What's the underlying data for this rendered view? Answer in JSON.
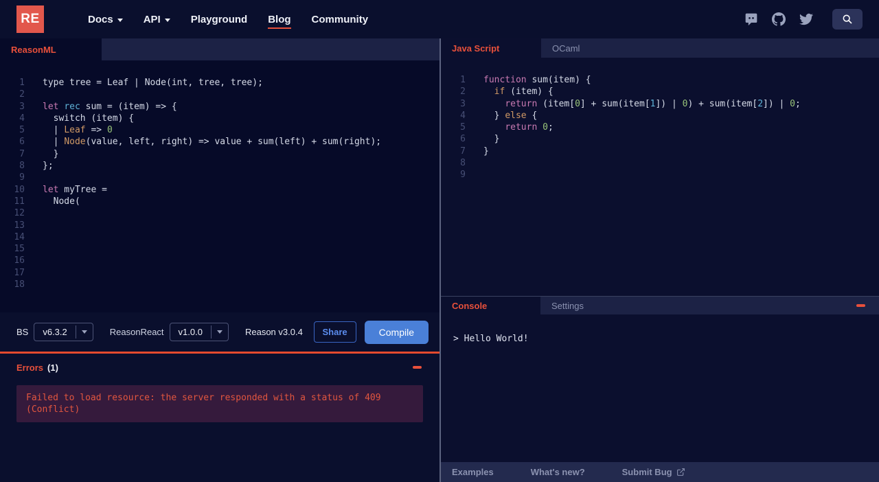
{
  "navbar": {
    "logo": "RE",
    "items": [
      {
        "label": "Docs"
      },
      {
        "label": "API"
      },
      {
        "label": "Playground"
      },
      {
        "label": "Blog"
      },
      {
        "label": "Community"
      }
    ],
    "icons": [
      "discord-icon",
      "github-icon",
      "twitter-icon",
      "search-icon"
    ]
  },
  "left": {
    "tab": "ReasonML",
    "code": [
      [
        [
          "w",
          "type tree = Leaf | Node(int, tree, tree);"
        ]
      ],
      [],
      [
        [
          "p",
          "let"
        ],
        [
          "w",
          " "
        ],
        [
          "c",
          "rec"
        ],
        [
          "w",
          " sum = (item) => {"
        ]
      ],
      [
        [
          "w",
          "  switch (item) {"
        ]
      ],
      [
        [
          "w",
          "  | "
        ],
        [
          "o",
          "Leaf"
        ],
        [
          "w",
          " => "
        ],
        [
          "g",
          "0"
        ]
      ],
      [
        [
          "w",
          "  | "
        ],
        [
          "o",
          "Node"
        ],
        [
          "w",
          "(value, left, right) => value + sum(left) + sum(right);"
        ]
      ],
      [
        [
          "w",
          "  }"
        ]
      ],
      [
        [
          "w",
          "};"
        ]
      ],
      [],
      [
        [
          "p",
          "let"
        ],
        [
          "w",
          " myTree ="
        ]
      ],
      [
        [
          "w",
          "  Node("
        ]
      ],
      [],
      [],
      [],
      [],
      [],
      [],
      []
    ],
    "toolbar": {
      "bs_label": "BS",
      "bs_version": "v6.3.2",
      "reasonreact_label": "ReasonReact",
      "reasonreact_version": "v1.0.0",
      "reason_version": "Reason v3.0.4",
      "share_label": "Share",
      "compile_label": "Compile"
    },
    "errors": {
      "title": "Errors",
      "count": "(1)",
      "message": "Failed to load resource: the server responded with a status of 409 (Conflict)"
    }
  },
  "right": {
    "tab_active": "Java Script",
    "tab_inactive": "OCaml",
    "code": [
      [
        [
          "p",
          "function"
        ],
        [
          "w",
          " sum(item) {"
        ]
      ],
      [
        [
          "w",
          "  "
        ],
        [
          "o",
          "if"
        ],
        [
          "w",
          " (item) {"
        ]
      ],
      [
        [
          "w",
          "    "
        ],
        [
          "p",
          "return"
        ],
        [
          "w",
          " (item["
        ],
        [
          "g",
          "0"
        ],
        [
          "w",
          "] + sum(item["
        ],
        [
          "c",
          "1"
        ],
        [
          "w",
          "]) | "
        ],
        [
          "g",
          "0"
        ],
        [
          "w",
          ") + sum(item["
        ],
        [
          "c",
          "2"
        ],
        [
          "w",
          "]) | "
        ],
        [
          "g",
          "0"
        ],
        [
          "w",
          ";"
        ]
      ],
      [
        [
          "w",
          "  } "
        ],
        [
          "o",
          "else"
        ],
        [
          "w",
          " {"
        ]
      ],
      [
        [
          "w",
          "    "
        ],
        [
          "p",
          "return"
        ],
        [
          "w",
          " "
        ],
        [
          "g",
          "0"
        ],
        [
          "w",
          ";"
        ]
      ],
      [
        [
          "w",
          "  }"
        ]
      ],
      [
        [
          "w",
          "}"
        ]
      ],
      [],
      []
    ],
    "console": {
      "tab_active": "Console",
      "tab_inactive": "Settings",
      "output": "> Hello World!"
    },
    "footer": {
      "examples": "Examples",
      "whats_new": "What's new?",
      "submit_bug": "Submit Bug"
    }
  },
  "colors": {
    "accent_red": "#e8503b",
    "accent_border": "#e54a2e",
    "logo_red": "#e2574c",
    "compile_blue": "#4a80d8",
    "share_blue": "#5b8cee",
    "error_box_bg": "#351a3c",
    "editor_bg_left": "#060a28",
    "editor_bg_right": "#0b0f2e",
    "tabbar_bg": "#1c2245",
    "footer_bg": "#232a4e"
  }
}
